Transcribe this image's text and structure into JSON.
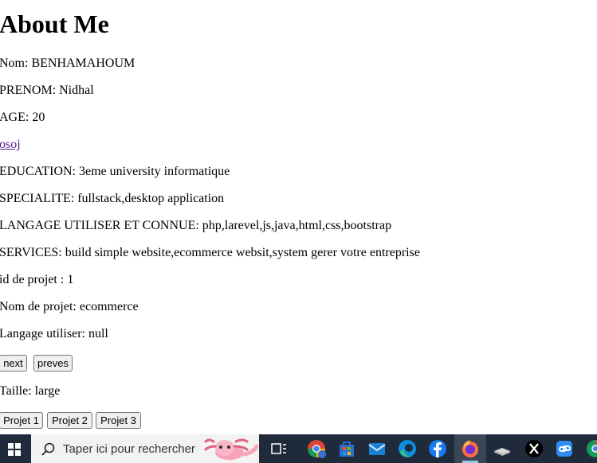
{
  "page": {
    "title": "About Me",
    "nom": "Nom: BENHAMAHOUM",
    "prenom": "PRENOM: Nidhal",
    "age": "AGE: 20",
    "link": "osoj",
    "education": "EDUCATION: 3eme university informatique",
    "specialite": "SPECIALITE: fullstack,desktop application",
    "langages": "LANGAGE UTILISER ET CONNUE: php,larevel,js,java,html,css,bootstrap",
    "services": "SERVICES: build simple website,ecommerce websit,system gerer votre entreprise",
    "projet_id": "id de projet : 1",
    "projet_nom": "Nom de projet: ecommerce",
    "projet_langage": "Langage utiliser: null",
    "next_label": "next",
    "preves_label": "preves",
    "taille": "Taille: large",
    "projet_buttons": [
      "Projet 1",
      "Projet 2",
      "Projet 3"
    ]
  },
  "taskbar": {
    "search_placeholder": "Taper ici pour rechercher",
    "icons": [
      "windows-start-icon",
      "search-icon",
      "task-view-icon",
      "chrome-icon",
      "microsoft-store-icon",
      "mail-icon",
      "edge-icon",
      "facebook-icon",
      "firefox-icon",
      "drive-icon",
      "x-icon",
      "link-app-icon",
      "chrome-partial-icon"
    ]
  },
  "colors": {
    "link": "#551a8b",
    "taskbar_bg": "#1f2a3a",
    "search_bg": "#f2f2f2"
  }
}
